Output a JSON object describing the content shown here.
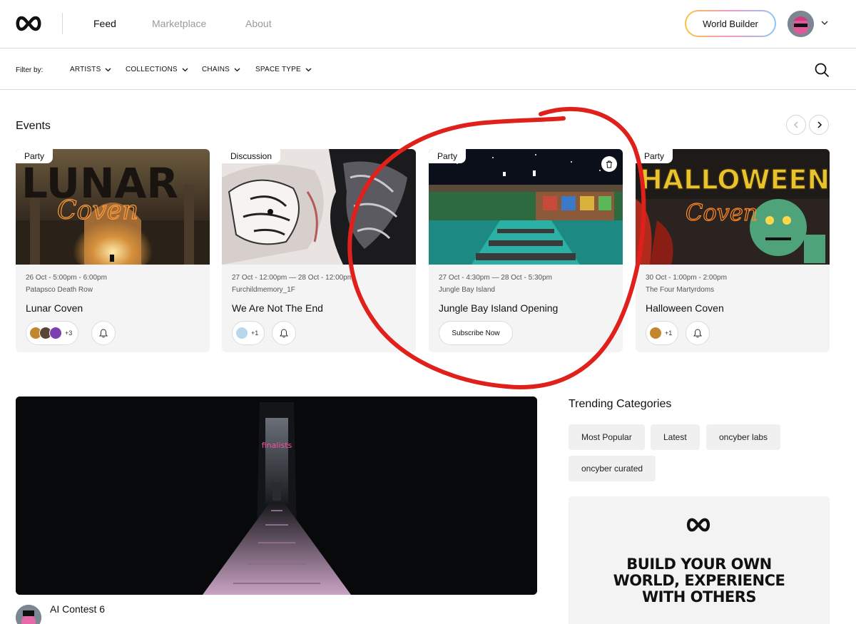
{
  "header": {
    "nav": [
      "Feed",
      "Marketplace",
      "About"
    ],
    "active_nav": "Feed",
    "world_builder_label": "World Builder"
  },
  "filters": {
    "label": "Filter by:",
    "items": [
      "ARTISTS",
      "COLLECTIONS",
      "CHAINS",
      "SPACE TYPE"
    ]
  },
  "events": {
    "title": "Events",
    "cards": [
      {
        "tag": "Party",
        "date": "26 Oct - 5:00pm - 6:00pm",
        "venue": "Patapsco Death Row",
        "title": "Lunar Coven",
        "attendee_count": "+3",
        "image_text": [
          "LUNAR",
          "Coven"
        ]
      },
      {
        "tag": "Discussion",
        "date": "27 Oct - 12:00pm — 28 Oct - 12:00pm",
        "venue": "Furchildmemory_1F",
        "title": "We Are Not The End",
        "attendee_count": "+1"
      },
      {
        "tag": "Party",
        "date": "27 Oct - 4:30pm — 28 Oct - 5:30pm",
        "venue": "Jungle Bay Island",
        "title": "Jungle Bay Island Opening",
        "subscribe_label": "Subscribe Now"
      },
      {
        "tag": "Party",
        "date": "30 Oct - 1:00pm - 2:00pm",
        "venue": "The Four Martyrdoms",
        "title": "Halloween Coven",
        "attendee_count": "+1",
        "image_text": [
          "HALLOWEEN",
          "Coven"
        ]
      }
    ]
  },
  "featured": {
    "title": "AI Contest 6",
    "image_text": "finalists"
  },
  "trending": {
    "title": "Trending Categories",
    "chips": [
      "Most Popular",
      "Latest",
      "oncyber labs",
      "oncyber curated"
    ]
  },
  "promo": {
    "lines": [
      "BUILD YOUR OWN",
      "WORLD, EXPERIENCE",
      "WITH OTHERS"
    ]
  },
  "colors": {
    "accent_gradient": [
      "#f6c343",
      "#f39ac6",
      "#8cc6f5"
    ],
    "annotation": "#e0201b"
  }
}
